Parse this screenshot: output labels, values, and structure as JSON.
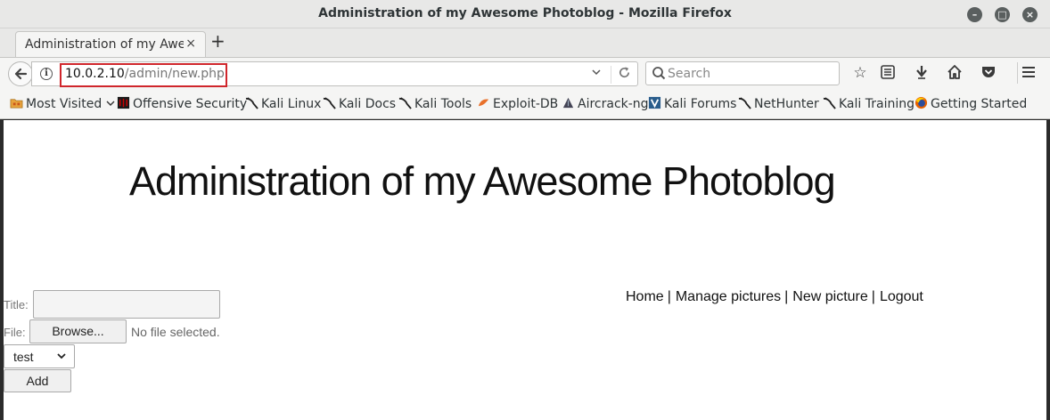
{
  "window": {
    "title": "Administration of my Awesome Photoblog - Mozilla Firefox",
    "minimize_icon": "minimize-icon",
    "maximize_icon": "maximize-icon",
    "close_icon": "close-icon"
  },
  "tabs": [
    {
      "label": "Administration of my Awe...",
      "close": "×"
    }
  ],
  "new_tab_label": "+",
  "navbar": {
    "url_host": "10.0.2.10",
    "url_path": "/admin/new.php",
    "search_placeholder": "Search",
    "highlight_color": "#d0262c"
  },
  "bookmarks": [
    {
      "label": "Most Visited",
      "icon": "folder-icon"
    },
    {
      "label": "Offensive Security",
      "icon": "offsec-icon"
    },
    {
      "label": "Kali Linux",
      "icon": "kali-icon"
    },
    {
      "label": "Kali Docs",
      "icon": "kali-icon"
    },
    {
      "label": "Kali Tools",
      "icon": "kali-icon"
    },
    {
      "label": "Exploit-DB",
      "icon": "exploit-db-icon"
    },
    {
      "label": "Aircrack-ng",
      "icon": "aircrack-icon"
    },
    {
      "label": "Kali Forums",
      "icon": "kali-forums-icon"
    },
    {
      "label": "NetHunter",
      "icon": "kali-icon"
    },
    {
      "label": "Kali Training",
      "icon": "kali-icon"
    },
    {
      "label": "Getting Started",
      "icon": "firefox-icon"
    }
  ],
  "page": {
    "heading": "Administration of my Awesome Photoblog",
    "menu": [
      {
        "label": "Home"
      },
      {
        "label": "Manage pictures"
      },
      {
        "label": "New picture"
      },
      {
        "label": "Logout"
      }
    ],
    "menu_separator": "|",
    "form": {
      "title_label": "Title:",
      "title_value": "",
      "file_label": "File:",
      "browse_label": "Browse...",
      "no_file_text": "No file selected.",
      "category_selected": "test",
      "add_label": "Add"
    }
  }
}
